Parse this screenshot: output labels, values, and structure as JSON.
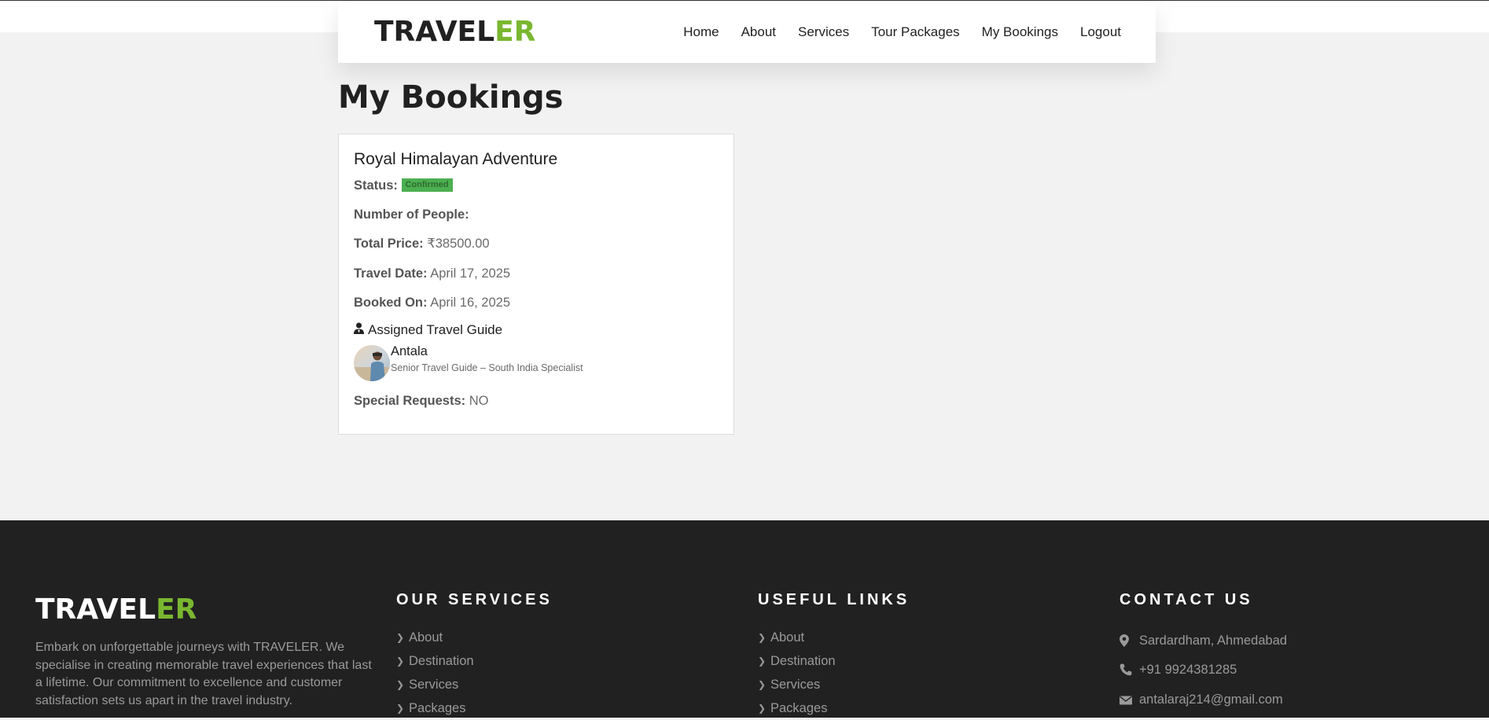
{
  "brand": {
    "part1": "TRAVEL",
    "part2": "ER",
    "accent": "#7ab730"
  },
  "nav": {
    "items": [
      "Home",
      "About",
      "Services",
      "Tour Packages",
      "My Bookings",
      "Logout"
    ]
  },
  "page": {
    "title": "My Bookings"
  },
  "booking": {
    "tour_name": "Royal Himalayan Adventure",
    "status_label": "Status:",
    "status_value": "Confirmed",
    "people_label": "Number of People:",
    "people_value": "",
    "price_label": "Total Price:",
    "price_value": "₹38500.00",
    "travel_date_label": "Travel Date:",
    "travel_date_value": "April 17, 2025",
    "booked_on_label": "Booked On:",
    "booked_on_value": "April 16, 2025",
    "guide_heading": "Assigned Travel Guide",
    "guide_name": "Antala",
    "guide_role": "Senior Travel Guide – South India Specialist",
    "requests_label": "Special Requests:",
    "requests_value": "NO"
  },
  "footer": {
    "about_text": "Embark on unforgettable journeys with TRAVELER. We specialise in creating memorable travel experiences that last a lifetime. Our commitment to excellence and customer satisfaction sets us apart in the travel industry.",
    "services": {
      "heading": "OUR SERVICES",
      "items": [
        "About",
        "Destination",
        "Services",
        "Packages"
      ]
    },
    "links": {
      "heading": "USEFUL LINKS",
      "items": [
        "About",
        "Destination",
        "Services",
        "Packages"
      ]
    },
    "contact": {
      "heading": "CONTACT US",
      "address": "Sardardham, Ahmedabad",
      "phone": "+91 9924381285",
      "email": "antalaraj214@gmail.com"
    }
  },
  "icons": {
    "guide": "user-tie-icon",
    "chevron": "chevron-right-icon",
    "address": "map-marker-icon",
    "phone": "phone-icon",
    "email": "envelope-icon"
  }
}
